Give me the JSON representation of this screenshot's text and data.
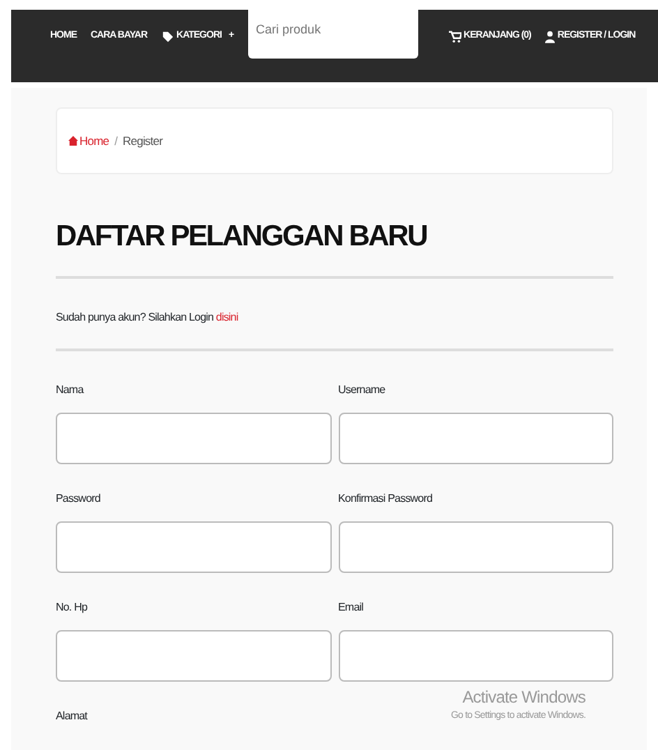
{
  "navbar": {
    "items": [
      {
        "label": "HOME"
      },
      {
        "label": "CARA BAYAR"
      },
      {
        "label": "KATEGORI",
        "caret": "+"
      }
    ],
    "search": {
      "placeholder": "Cari produk"
    },
    "right_items": [
      {
        "label": "KERANJANG (0)"
      },
      {
        "label": "REGISTER / LOGIN"
      }
    ]
  },
  "breadcrumb": [
    {
      "label": "Home",
      "selected": false
    },
    {
      "separator": "/"
    },
    {
      "label": "Register",
      "selected": true
    }
  ],
  "heading": "DAFTAR PELANGGAN BARU",
  "login_prompt": {
    "text": "Sudah punya akun? Silahkan Login",
    "link": "disini"
  },
  "fields": [
    {
      "label": "Nama"
    },
    {
      "label": "Username"
    },
    {
      "label": "Password"
    },
    {
      "label": "Konfirmasi Password"
    },
    {
      "label": "No. Hp"
    },
    {
      "label": "Email"
    },
    {
      "label": "Alamat"
    }
  ],
  "activation_notice": {
    "title": "Activate Windows",
    "text": "Go to Settings to activate Windows."
  }
}
